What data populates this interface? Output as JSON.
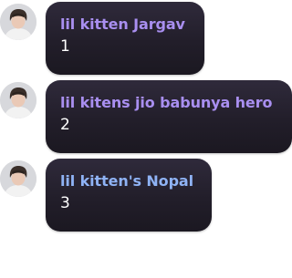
{
  "messages": [
    {
      "author": "lil kitten Jargav",
      "text": "1",
      "name_color": "#a98ff0",
      "avatar": "user-avatar"
    },
    {
      "author": "lil kitens jio babunya hero",
      "text": "2",
      "name_color": "#a98ff0",
      "avatar": "user-avatar"
    },
    {
      "author": "lil kitten's Nopal",
      "text": "3",
      "name_color": "#8fb3f5",
      "avatar": "user-avatar"
    }
  ],
  "colors": {
    "bubble_bg": "#231f2b",
    "message_text": "#ffffff",
    "page_bg": "#ffffff"
  }
}
